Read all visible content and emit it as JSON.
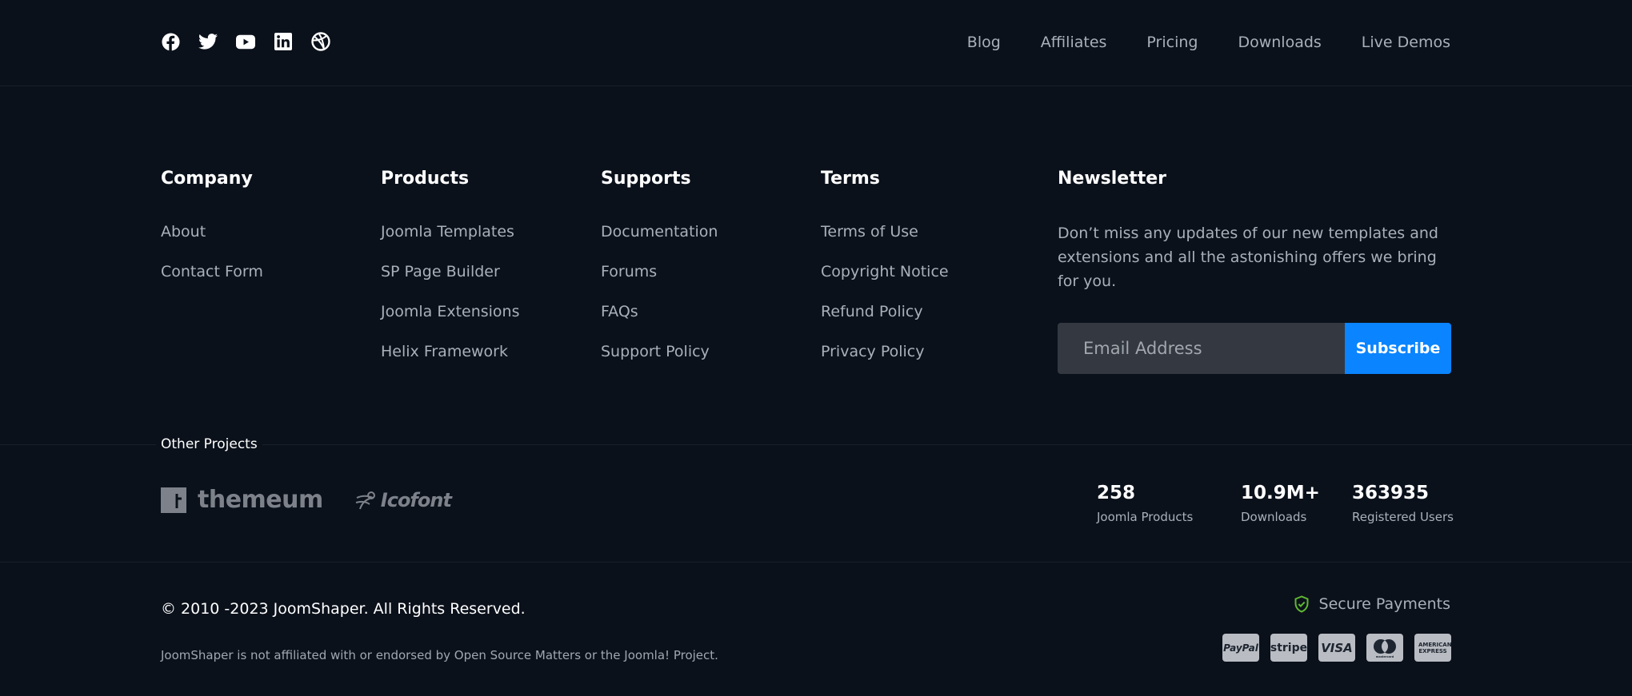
{
  "social": {
    "icons": [
      "facebook-icon",
      "twitter-icon",
      "youtube-icon",
      "linkedin-icon",
      "dribbble-icon"
    ]
  },
  "topnav": {
    "items": [
      "Blog",
      "Affiliates",
      "Pricing",
      "Downloads",
      "Live Demos"
    ]
  },
  "columns": {
    "company": {
      "title": "Company",
      "links": [
        "About",
        "Contact Form"
      ]
    },
    "products": {
      "title": "Products",
      "links": [
        "Joomla Templates",
        "SP Page Builder",
        "Joomla Extensions",
        "Helix Framework"
      ]
    },
    "supports": {
      "title": "Supports",
      "links": [
        "Documentation",
        "Forums",
        "FAQs",
        "Support Policy"
      ]
    },
    "terms": {
      "title": "Terms",
      "links": [
        "Terms of Use",
        "Copyright Notice",
        "Refund Policy",
        "Privacy Policy"
      ]
    }
  },
  "newsletter": {
    "title": "Newsletter",
    "text": "Don’t miss any updates of our new templates and extensions and all the astonishing offers we bring for you.",
    "placeholder": "Email Address",
    "button": "Subscribe"
  },
  "other_projects": {
    "label": "Other Projects",
    "logos": [
      "themeum",
      "Icofont"
    ]
  },
  "stats": [
    {
      "value": "258",
      "label": "Joomla Products"
    },
    {
      "value": "10.9M+",
      "label": "Downloads"
    },
    {
      "value": "363935",
      "label": "Registered Users"
    }
  ],
  "footer": {
    "copyright": "© 2010 -2023 JoomShaper. All Rights Reserved.",
    "disclaimer": "JoomShaper is not affiliated with or endorsed by Open Source Matters or the Joomla! Project.",
    "secure_payments": "Secure Payments",
    "payment_icons": [
      "PayPal",
      "stripe",
      "VISA",
      "mastercard",
      "AMERICAN EXPRESS"
    ]
  },
  "colors": {
    "background": "#0b111b",
    "accent": "#0a84ff",
    "secure_check": "#5fb832"
  }
}
